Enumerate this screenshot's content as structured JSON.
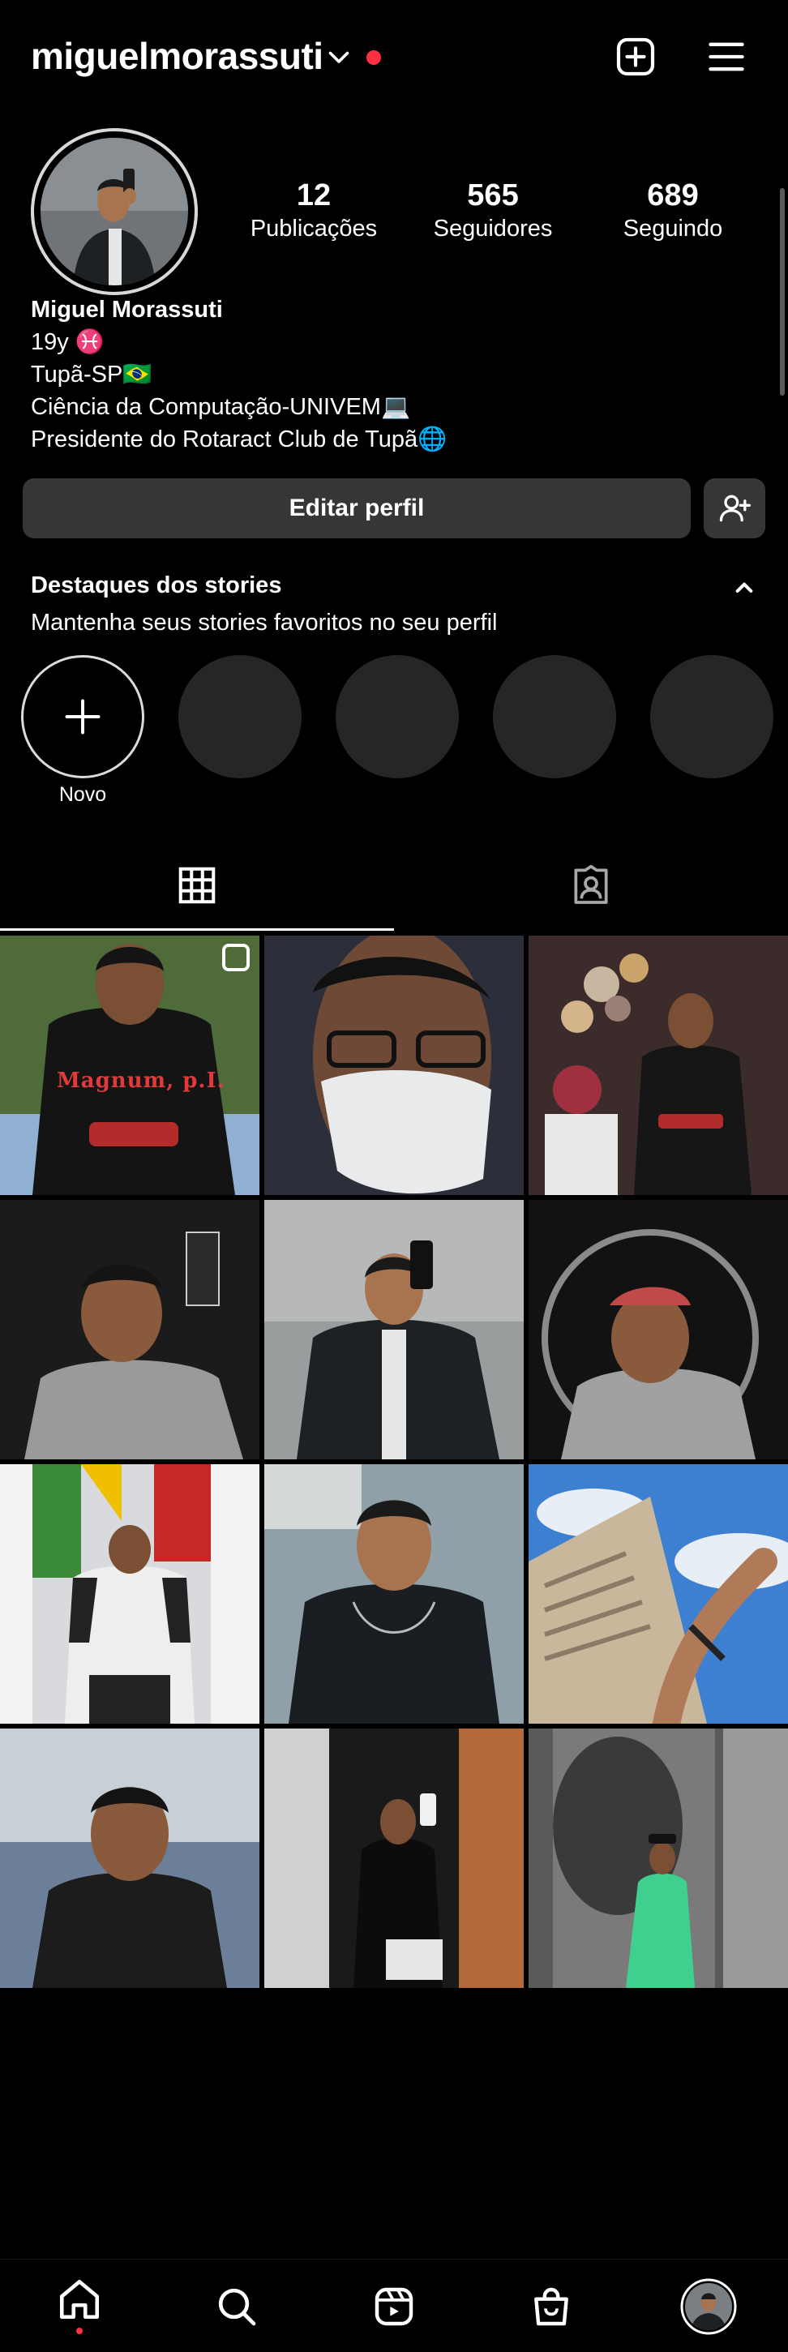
{
  "header": {
    "username": "miguelmorassuti"
  },
  "stats": [
    {
      "value": "12",
      "label": "Publicações"
    },
    {
      "value": "565",
      "label": "Seguidores"
    },
    {
      "value": "689",
      "label": "Seguindo"
    }
  ],
  "bio": {
    "name": "Miguel Morassuti",
    "lines": [
      "19y ♓",
      "Tupã-SP🇧🇷",
      "Ciência da Computação-UNIVEM💻",
      "Presidente do Rotaract Club de Tupã🌐"
    ]
  },
  "actions": {
    "edit_profile": "Editar perfil"
  },
  "highlights": {
    "title": "Destaques dos stories",
    "subtitle": "Mantenha seus stories favoritos no seu perfil",
    "new_label": "Novo"
  },
  "grid": {
    "photos": [
      {
        "desc": "man-black-tshirt-magnum",
        "text": "Magnum, p.I."
      },
      {
        "desc": "man-glasses-mask"
      },
      {
        "desc": "man-party-balloons"
      },
      {
        "desc": "man-hoodie-smile"
      },
      {
        "desc": "man-mirror-selfie-suit"
      },
      {
        "desc": "man-ring-light"
      },
      {
        "desc": "man-flags-tshirt"
      },
      {
        "desc": "man-tank-top"
      },
      {
        "desc": "wrist-bracelets-sky"
      },
      {
        "desc": "man-tank-top-sun"
      },
      {
        "desc": "man-mirror-selfie-black"
      },
      {
        "desc": "man-graffiti-wall"
      }
    ]
  },
  "colors": {
    "background": "#000000",
    "button": "#363636",
    "notification": "#ff3040",
    "highlight_empty": "#262626"
  },
  "icons": {
    "header": [
      "chevron-down-icon",
      "new-post-icon",
      "menu-icon"
    ],
    "tabs": [
      "grid-icon",
      "tagged-icon"
    ],
    "nav": [
      "home-icon",
      "search-icon",
      "reels-icon",
      "shop-icon",
      "profile-avatar"
    ]
  }
}
